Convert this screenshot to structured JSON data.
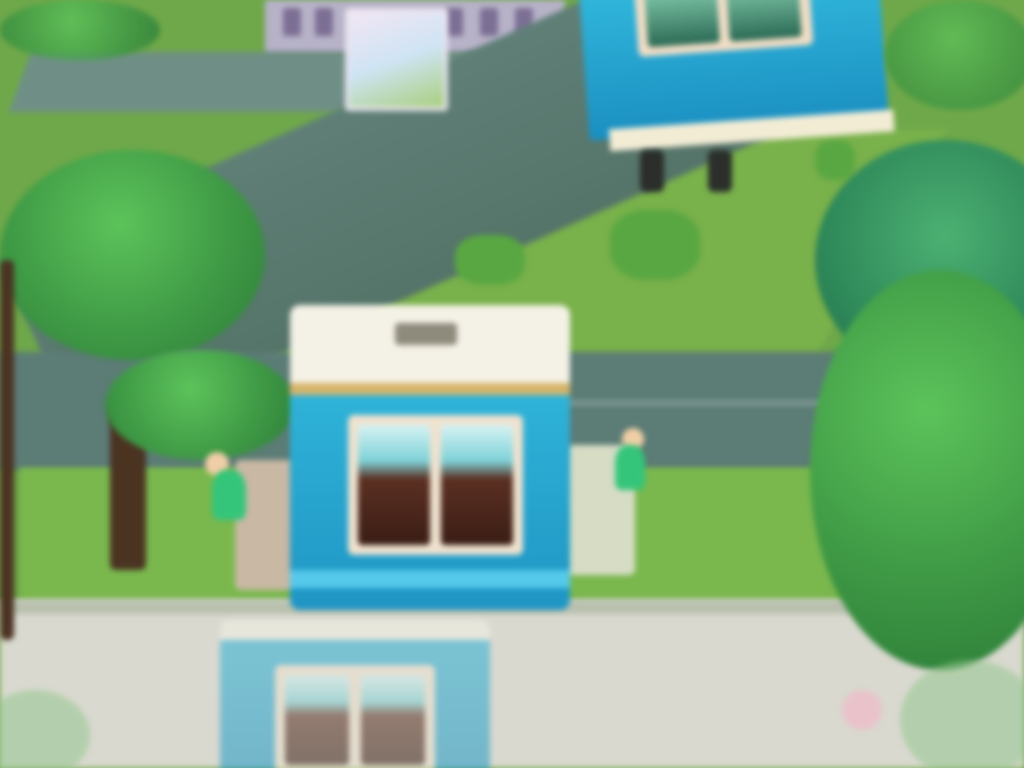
{
  "scene": {
    "kind": "isometric-town",
    "elements": [
      "building",
      "poster",
      "road",
      "grass",
      "trees",
      "bushes",
      "blue-cube-machine",
      "characters"
    ],
    "colors": {
      "grass": "#7ab84e",
      "road": "#5c7c76",
      "pavement": "#d9d9cf",
      "machine_blue": "#2fb3d8",
      "machine_top": "#f4f1e6",
      "tree_green": "#3f9a45"
    }
  }
}
